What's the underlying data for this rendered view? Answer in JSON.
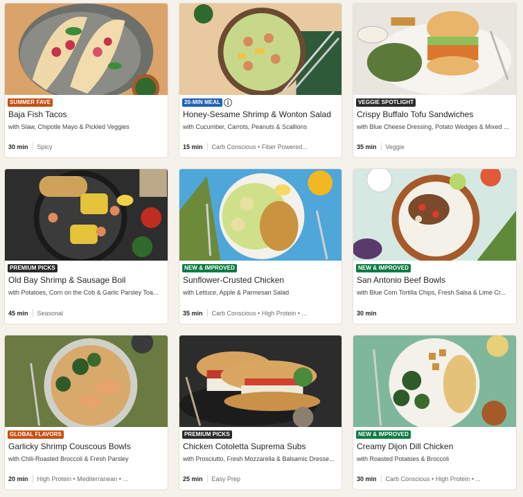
{
  "colors": {
    "badge_orange": "#c94f12",
    "badge_blue": "#1f62b6",
    "badge_dark": "#2b2b2b",
    "badge_green": "#0e7a43"
  },
  "recipes": [
    {
      "badge": "SUMMER FAVE",
      "badge_color": "#c94f12",
      "title": "Baja Fish Tacos",
      "subtitle": "with Slaw, Chipotle Mayo & Pickled Veggies",
      "time": "30 min",
      "tags": "Spicy",
      "info_icon": "info-icon"
    },
    {
      "badge": "20-MIN MEAL",
      "badge_color": "#1f62b6",
      "title": "Honey-Sesame Shrimp & Wonton Salad",
      "subtitle": "with Cucumber, Carrots, Peanuts & Scallions",
      "time": "15 min",
      "tags": "Carb Conscious • Fiber Powered...",
      "info_icon": "info-icon"
    },
    {
      "badge": "VEGGIE SPOTLIGHT",
      "badge_color": "#2b2b2b",
      "title": "Crispy Buffalo Tofu Sandwiches",
      "subtitle": "with Blue Cheese Dressing, Potato Wedges & Mixed ...",
      "time": "35 min",
      "tags": "Veggie"
    },
    {
      "badge": "PREMIUM PICKS",
      "badge_color": "#2b2b2b",
      "title": "Old Bay Shrimp & Sausage Boil",
      "subtitle": "with Potatoes, Corn on the Cob & Garlic Parsley Toa...",
      "time": "45 min",
      "tags": "Seasonal"
    },
    {
      "badge": "NEW & IMPROVED",
      "badge_color": "#0e7a43",
      "title": "Sunflower-Crusted Chicken",
      "subtitle": "with Lettuce, Apple & Parmesan Salad",
      "time": "35 min",
      "tags": "Carb Conscious • High Protein • ..."
    },
    {
      "badge": "NEW & IMPROVED",
      "badge_color": "#0e7a43",
      "title": "San Antonio Beef Bowls",
      "subtitle": "with Blue Corn Tortilla Chips, Fresh Salsa & Lime Cr...",
      "time": "30 min",
      "tags": ""
    },
    {
      "badge": "GLOBAL FLAVORS",
      "badge_color": "#c94f12",
      "title": "Garlicky Shrimp Couscous Bowls",
      "subtitle": "with Chili-Roasted Broccoli & Fresh Parsley",
      "time": "20 min",
      "tags": "High Protein • Mediterranean • ..."
    },
    {
      "badge": "PREMIUM PICKS",
      "badge_color": "#2b2b2b",
      "title": "Chicken Cotoletta Suprema Subs",
      "subtitle": "with Prosciutto, Fresh Mozzarella & Balsamic Dresse...",
      "time": "25 min",
      "tags": "Easy Prep"
    },
    {
      "badge": "NEW & IMPROVED",
      "badge_color": "#0e7a43",
      "title": "Creamy Dijon Dill Chicken",
      "subtitle": "with Roasted Potatoes & Broccoli",
      "time": "30 min",
      "tags": "Carb Conscious • High Protein • ..."
    }
  ],
  "info_glyph": "i"
}
